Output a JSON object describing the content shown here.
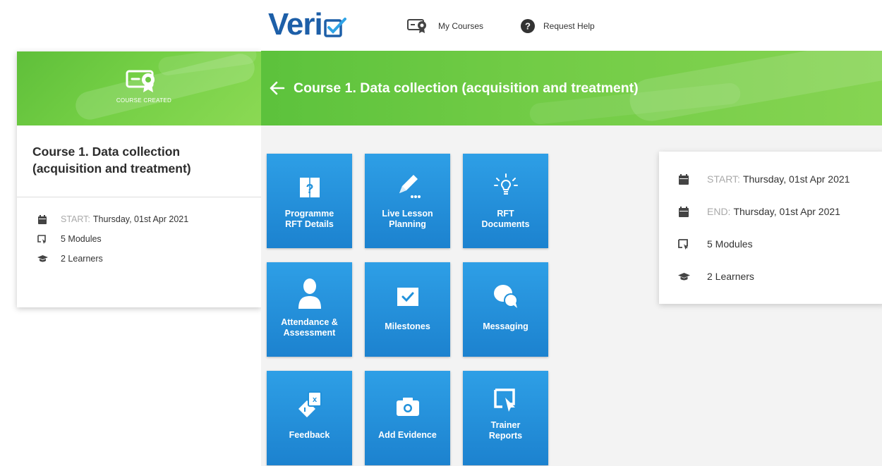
{
  "left_card": {
    "banner_label": "COURSE CREATED",
    "title": "Course 1. Data collection (acquisition and treatment)",
    "start_label": "START:",
    "start_value": "Thursday, 01st Apr 2021",
    "modules": "5 Modules",
    "learners": "2 Learners"
  },
  "topbar": {
    "logo": "Veri",
    "my_courses": "My Courses",
    "request_help": "Request Help"
  },
  "header": {
    "title": "Course 1. Data collection (acquisition and treatment)"
  },
  "tiles": [
    {
      "label_line1": "Programme",
      "label_line2": "RFT Details",
      "icon": "question-book-icon"
    },
    {
      "label_line1": "Live Lesson",
      "label_line2": "Planning",
      "icon": "pencil-icon"
    },
    {
      "label_line1": "RFT",
      "label_line2": "Documents",
      "icon": "lightbulb-icon"
    },
    {
      "label_line1": "Attendance &",
      "label_line2": "Assessment",
      "icon": "person-icon"
    },
    {
      "label_line1": "Milestones",
      "label_line2": "",
      "icon": "check-book-icon"
    },
    {
      "label_line1": "Messaging",
      "label_line2": "",
      "icon": "chat-bubbles-icon"
    },
    {
      "label_line1": "Feedback",
      "label_line2": "",
      "icon": "feedback-cards-icon"
    },
    {
      "label_line1": "Add Evidence",
      "label_line2": "",
      "icon": "camera-icon"
    },
    {
      "label_line1": "Trainer",
      "label_line2": "Reports",
      "icon": "book-cursor-icon"
    }
  ],
  "info_card": {
    "start_label": "START:",
    "start_value": "Thursday, 01st Apr 2021",
    "end_label": "END:",
    "end_value": "Thursday, 01st Apr 2021",
    "modules": "5 Modules",
    "learners": "2 Learners"
  },
  "colors": {
    "brand_blue": "#1d5fa8",
    "tile_blue": "#2091db",
    "header_green": "#6cc843"
  }
}
